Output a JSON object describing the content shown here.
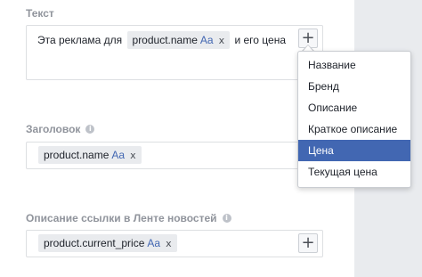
{
  "text_section": {
    "label": "Текст",
    "prefix": "Эта реклама для",
    "token": {
      "name": "product.name",
      "case": "Aa",
      "remove": "x"
    },
    "suffix": "и его цена",
    "add_label": "+"
  },
  "dropdown": {
    "items": [
      "Название",
      "Бренд",
      "Описание",
      "Краткое описание",
      "Цена",
      "Текущая цена"
    ],
    "selected_index": 4
  },
  "headline_section": {
    "label": "Заголовок",
    "info": "i",
    "token": {
      "name": "product.name",
      "case": "Aa",
      "remove": "x"
    }
  },
  "link_desc_section": {
    "label": "Описание ссылки в Ленте новостей",
    "info": "i",
    "token": {
      "name": "product.current_price",
      "case": "Aa",
      "remove": "x"
    },
    "add_label": "+"
  },
  "colors": {
    "accent": "#4267b2",
    "label": "#90949c",
    "token_bg": "#e9ebee"
  }
}
